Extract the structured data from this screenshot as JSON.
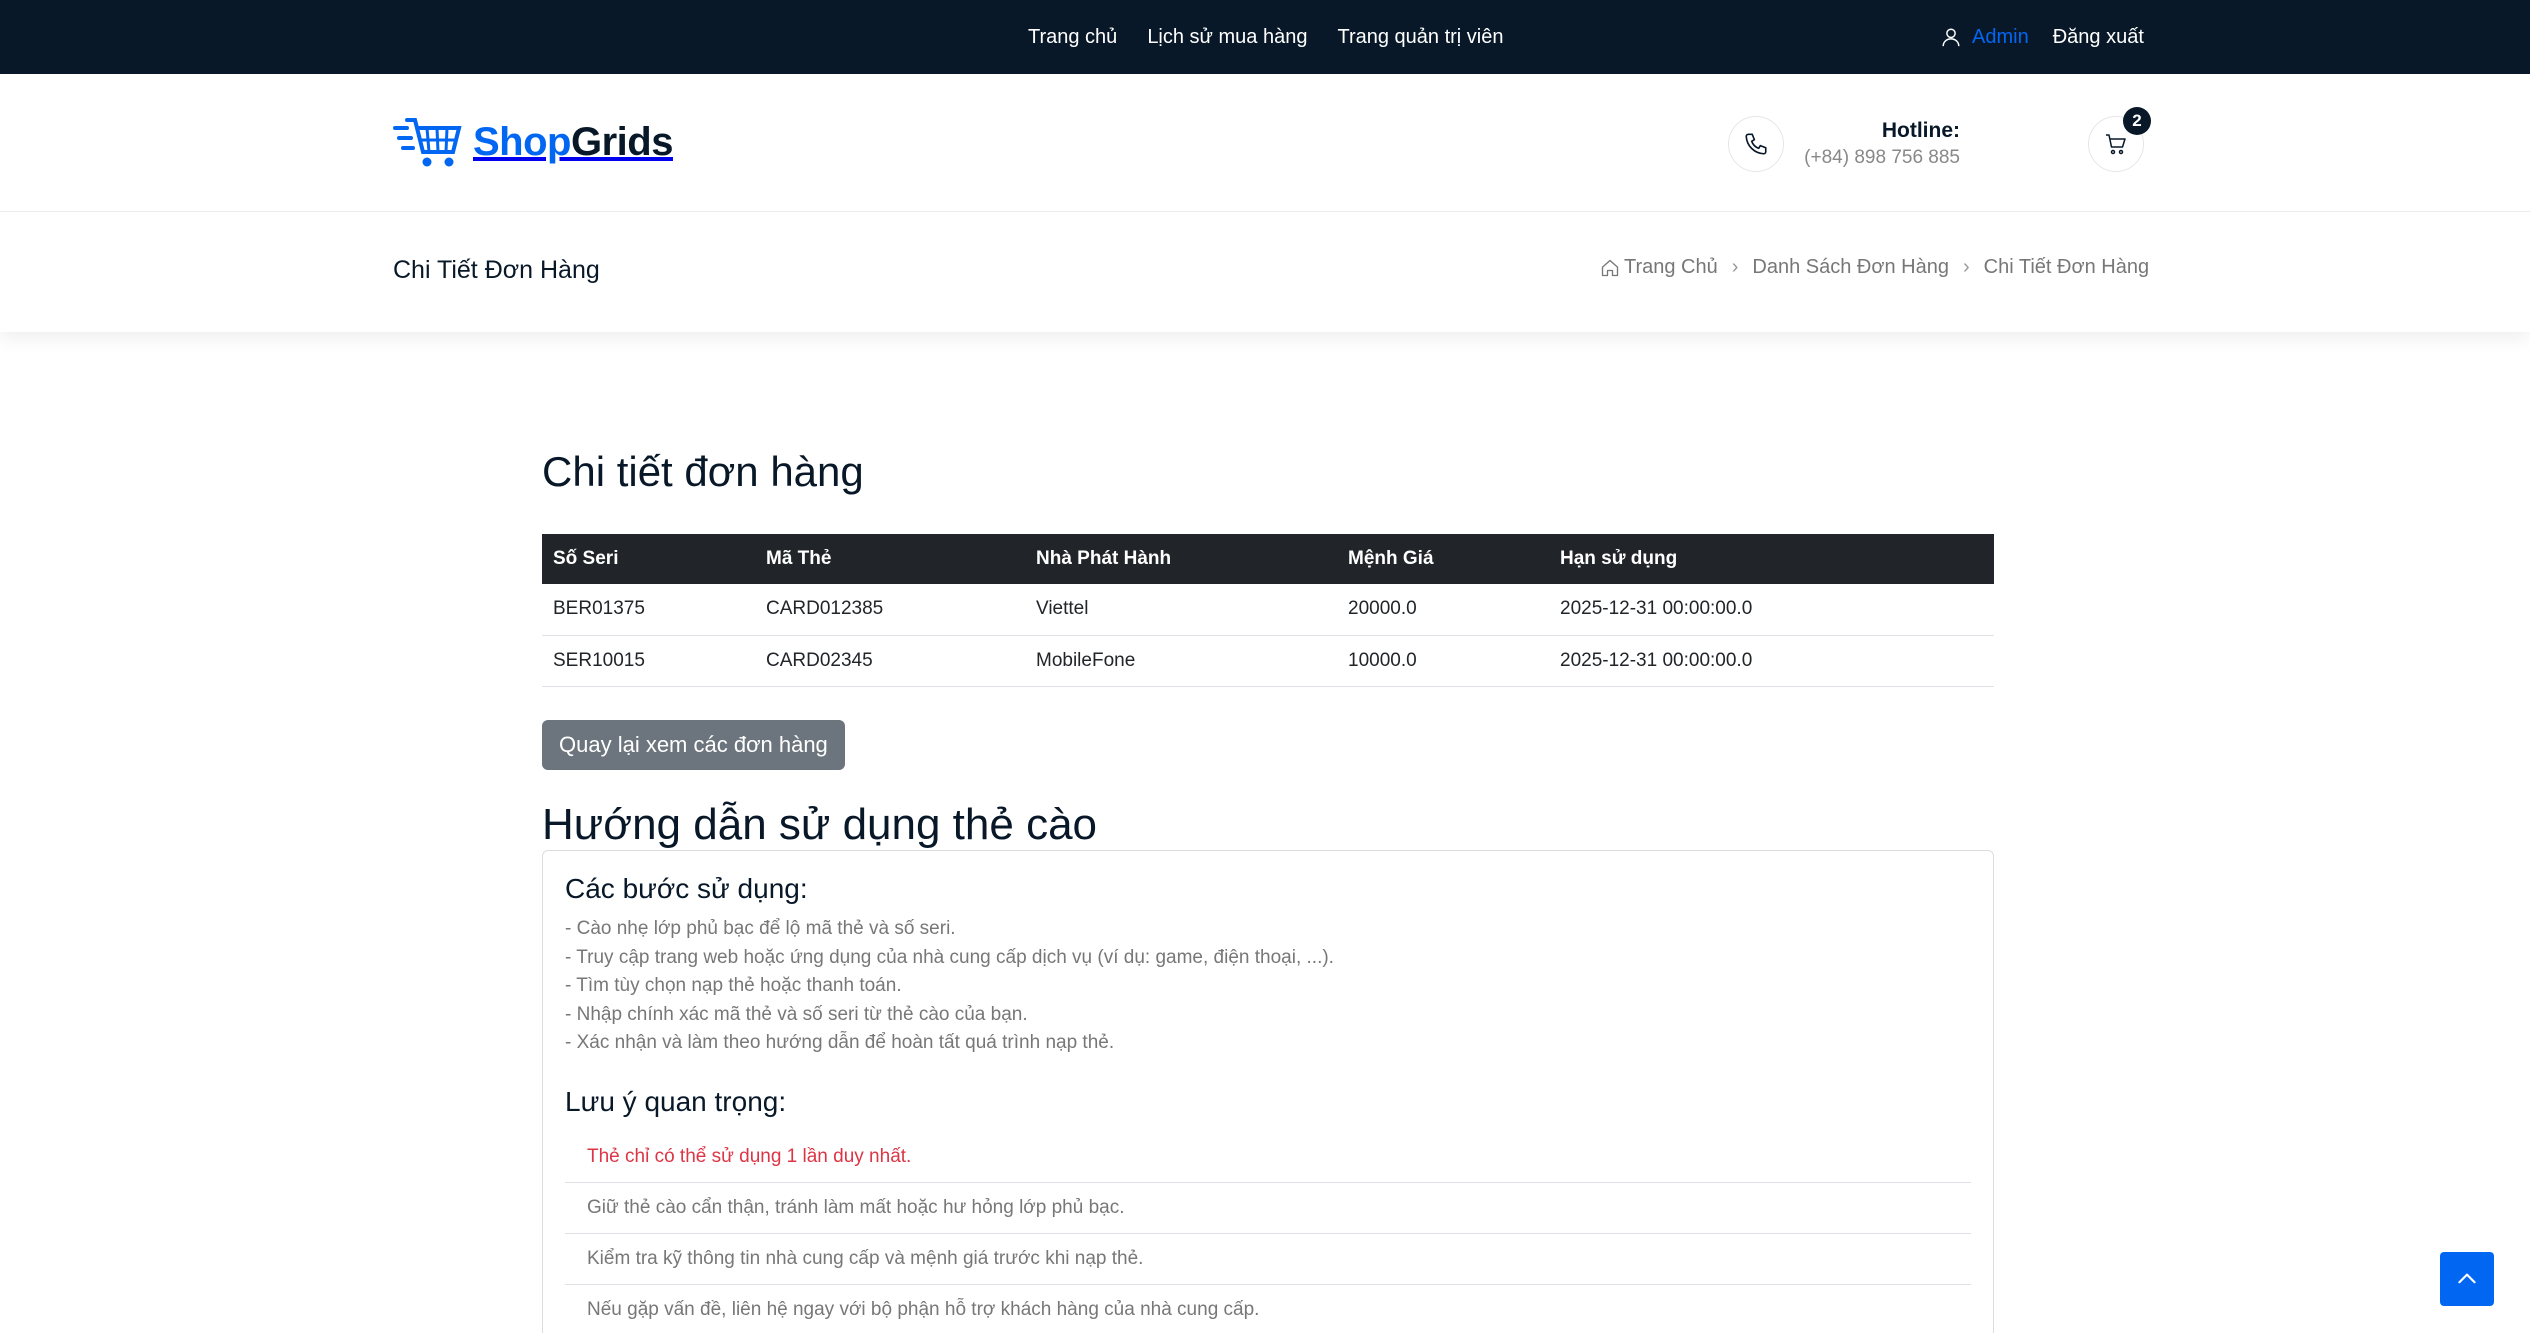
{
  "topbar": {
    "nav": [
      "Trang chủ",
      "Lịch sử mua hàng",
      "Trang quản trị viên"
    ],
    "user": "Admin",
    "logout": "Đăng xuất"
  },
  "header": {
    "logo_part1": "Shop",
    "logo_part2": "Grids",
    "hotline_label": "Hotline:",
    "hotline_number": "(+84) 898 756 885",
    "cart_count": "2"
  },
  "breadcrumbs": {
    "title": "Chi Tiết Đơn Hàng",
    "items": [
      "Trang Chủ",
      "Danh Sách Đơn Hàng",
      "Chi Tiết Đơn Hàng"
    ]
  },
  "order": {
    "heading": "Chi tiết đơn hàng",
    "columns": [
      "Số Seri",
      "Mã Thẻ",
      "Nhà Phát Hành",
      "Mệnh Giá",
      "Hạn sử dụng"
    ],
    "rows": [
      [
        "BER01375",
        "CARD012385",
        "Viettel",
        "20000.0",
        "2025-12-31 00:00:00.0"
      ],
      [
        "SER10015",
        "CARD02345",
        "MobileFone",
        "10000.0",
        "2025-12-31 00:00:00.0"
      ]
    ],
    "back_button": "Quay lại xem các đơn hàng"
  },
  "guide": {
    "heading": "Hướng dẫn sử dụng thẻ cào",
    "steps_title": "Các bước sử dụng:",
    "steps": [
      "- Cào nhẹ lớp phủ bạc để lộ mã thẻ và số seri.",
      "- Truy cập trang web hoặc ứng dụng của nhà cung cấp dịch vụ (ví dụ: game, điện thoại, ...).",
      "- Tìm tùy chọn nạp thẻ hoặc thanh toán.",
      "- Nhập chính xác mã thẻ và số seri từ thẻ cào của bạn.",
      "- Xác nhận và làm theo hướng dẫn để hoàn tất quá trình nạp thẻ."
    ],
    "notes_title": "Lưu ý quan trọng:",
    "notes": [
      "Thẻ chỉ có thể sử dụng 1 lần duy nhất.",
      "Giữ thẻ cào cẩn thận, tránh làm mất hoặc hư hỏng lớp phủ bạc.",
      "Kiểm tra kỹ thông tin nhà cung cấp và mệnh giá trước khi nạp thẻ.",
      "Nếu gặp vấn đề, liên hệ ngay với bộ phận hỗ trợ khách hàng của nhà cung cấp."
    ]
  },
  "colors": {
    "dark": "#081828",
    "accent": "#0167F3",
    "table_header": "#212529",
    "warning": "#dc3545",
    "button_secondary": "#6c757d"
  },
  "icons": [
    "user-icon",
    "cart-logo-icon",
    "phone-icon",
    "cart-icon",
    "home-icon",
    "chevron-right-icon",
    "arrow-up-icon"
  ]
}
